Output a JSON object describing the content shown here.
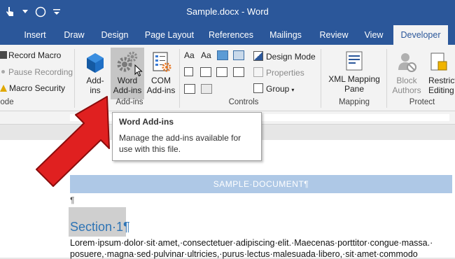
{
  "window": {
    "title": "Sample.docx - Word"
  },
  "tabs": [
    {
      "label": "Insert"
    },
    {
      "label": "Draw"
    },
    {
      "label": "Design"
    },
    {
      "label": "Page Layout"
    },
    {
      "label": "References"
    },
    {
      "label": "Mailings"
    },
    {
      "label": "Review"
    },
    {
      "label": "View"
    },
    {
      "label": "Developer",
      "active": true
    }
  ],
  "ribbon": {
    "code_group": {
      "record_macro": "Record Macro",
      "pause_recording": "Pause Recording",
      "macro_security": "Macro Security",
      "label_fragment": "ode"
    },
    "addins_group": {
      "addins_top": "Add-",
      "addins_bottom": "ins",
      "word_addins_top": "Word",
      "word_addins_bottom": "Add-ins",
      "com_addins_top": "COM",
      "com_addins_bottom": "Add-ins",
      "label": "Add-ins"
    },
    "controls_group": {
      "design_mode": "Design Mode",
      "properties": "Properties",
      "group": "Group",
      "label": "Controls"
    },
    "mapping_group": {
      "xml_top": "XML Mapping",
      "xml_bottom": "Pane",
      "label": "Mapping"
    },
    "protect_group": {
      "block_top": "Block",
      "block_bottom": "Authors",
      "restrict_top": "Restrict",
      "restrict_bottom": "Editing",
      "label": "Protect"
    }
  },
  "tooltip": {
    "title": "Word Add-ins",
    "description": "Manage the add-ins available for use with this file."
  },
  "document": {
    "banner": "SAMPLE·DOCUMENT¶",
    "pilcrow": "¶",
    "heading": "Section·1¶",
    "line1": "Lorem·ipsum·dolor·sit·amet,·consectetuer·adipiscing·elit.·Maecenas·porttitor·congue·massa.·",
    "line2": "posuere,·magna·sed·pulvinar·ultricies,·purus·lectus·malesuada·libero,·sit·amet·commodo"
  },
  "colors": {
    "title_bar": "#2b579a",
    "heading": "#2e74b5",
    "banner": "#aec8e6",
    "arrow": "#e02020"
  }
}
